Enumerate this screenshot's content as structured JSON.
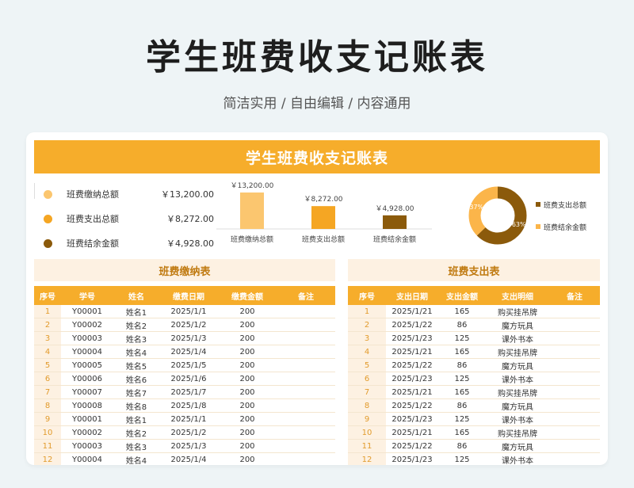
{
  "page": {
    "title": "学生班费收支记账表",
    "subtitle": "简洁实用 / 自由编辑 / 内容通用"
  },
  "card": {
    "banner": "学生班费收支记账表"
  },
  "summary": {
    "items": [
      {
        "label": "班费缴纳总额",
        "value": "￥13,200.00",
        "color": "#fbc66f"
      },
      {
        "label": "班费支出总额",
        "value": "￥8,272.00",
        "color": "#f5a623"
      },
      {
        "label": "班费结余金额",
        "value": "￥4,928.00",
        "color": "#8b5a0b"
      }
    ]
  },
  "chart_data": [
    {
      "type": "bar",
      "categories": [
        "班费缴纳总额",
        "班费支出总额",
        "班费结余金额"
      ],
      "values": [
        13200,
        8272,
        4928
      ],
      "data_labels": [
        "￥13,200.00",
        "￥8,272.00",
        "￥4,928.00"
      ],
      "colors": [
        "#fbc66f",
        "#f5a623",
        "#8b5a0b"
      ],
      "ylim": [
        0,
        13200
      ]
    },
    {
      "type": "pie",
      "donut": true,
      "labels": [
        "班费支出总额",
        "班费结余金额"
      ],
      "values": [
        8272,
        4928
      ],
      "data_labels": [
        "63%",
        "37%"
      ],
      "colors": [
        "#8b5a0b",
        "#fbb54a"
      ],
      "legend": "right"
    }
  ],
  "payments": {
    "title": "班费缴纳表",
    "columns": [
      "序号",
      "学号",
      "姓名",
      "缴费日期",
      "缴费金额",
      "备注"
    ],
    "rows": [
      [
        "1",
        "Y00001",
        "姓名1",
        "2025/1/1",
        "200",
        ""
      ],
      [
        "2",
        "Y00002",
        "姓名2",
        "2025/1/2",
        "200",
        ""
      ],
      [
        "3",
        "Y00003",
        "姓名3",
        "2025/1/3",
        "200",
        ""
      ],
      [
        "4",
        "Y00004",
        "姓名4",
        "2025/1/4",
        "200",
        ""
      ],
      [
        "5",
        "Y00005",
        "姓名5",
        "2025/1/5",
        "200",
        ""
      ],
      [
        "6",
        "Y00006",
        "姓名6",
        "2025/1/6",
        "200",
        ""
      ],
      [
        "7",
        "Y00007",
        "姓名7",
        "2025/1/7",
        "200",
        ""
      ],
      [
        "8",
        "Y00008",
        "姓名8",
        "2025/1/8",
        "200",
        ""
      ],
      [
        "9",
        "Y00001",
        "姓名1",
        "2025/1/1",
        "200",
        ""
      ],
      [
        "10",
        "Y00002",
        "姓名2",
        "2025/1/2",
        "200",
        ""
      ],
      [
        "11",
        "Y00003",
        "姓名3",
        "2025/1/3",
        "200",
        ""
      ],
      [
        "12",
        "Y00004",
        "姓名4",
        "2025/1/4",
        "200",
        ""
      ]
    ]
  },
  "expenses": {
    "title": "班费支出表",
    "columns": [
      "序号",
      "支出日期",
      "支出金额",
      "支出明细",
      "备注"
    ],
    "rows": [
      [
        "1",
        "2025/1/21",
        "165",
        "购买挂吊牌",
        ""
      ],
      [
        "2",
        "2025/1/22",
        "86",
        "魔方玩具",
        ""
      ],
      [
        "3",
        "2025/1/23",
        "125",
        "课外书本",
        ""
      ],
      [
        "4",
        "2025/1/21",
        "165",
        "购买挂吊牌",
        ""
      ],
      [
        "5",
        "2025/1/22",
        "86",
        "魔方玩具",
        ""
      ],
      [
        "6",
        "2025/1/23",
        "125",
        "课外书本",
        ""
      ],
      [
        "7",
        "2025/1/21",
        "165",
        "购买挂吊牌",
        ""
      ],
      [
        "8",
        "2025/1/22",
        "86",
        "魔方玩具",
        ""
      ],
      [
        "9",
        "2025/1/23",
        "125",
        "课外书本",
        ""
      ],
      [
        "10",
        "2025/1/21",
        "165",
        "购买挂吊牌",
        ""
      ],
      [
        "11",
        "2025/1/22",
        "86",
        "魔方玩具",
        ""
      ],
      [
        "12",
        "2025/1/23",
        "125",
        "课外书本",
        ""
      ]
    ]
  }
}
